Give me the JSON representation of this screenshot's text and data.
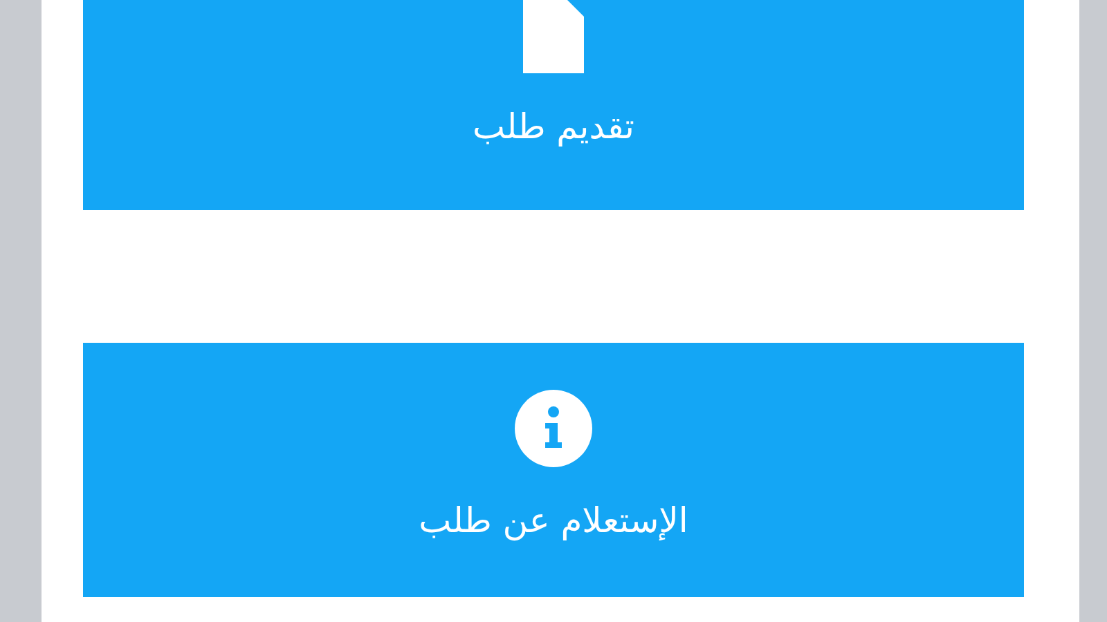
{
  "buttons": [
    {
      "kind": "document",
      "label": "تقديم طلب"
    },
    {
      "kind": "info",
      "label": "الإستعلام عن طلب"
    }
  ]
}
